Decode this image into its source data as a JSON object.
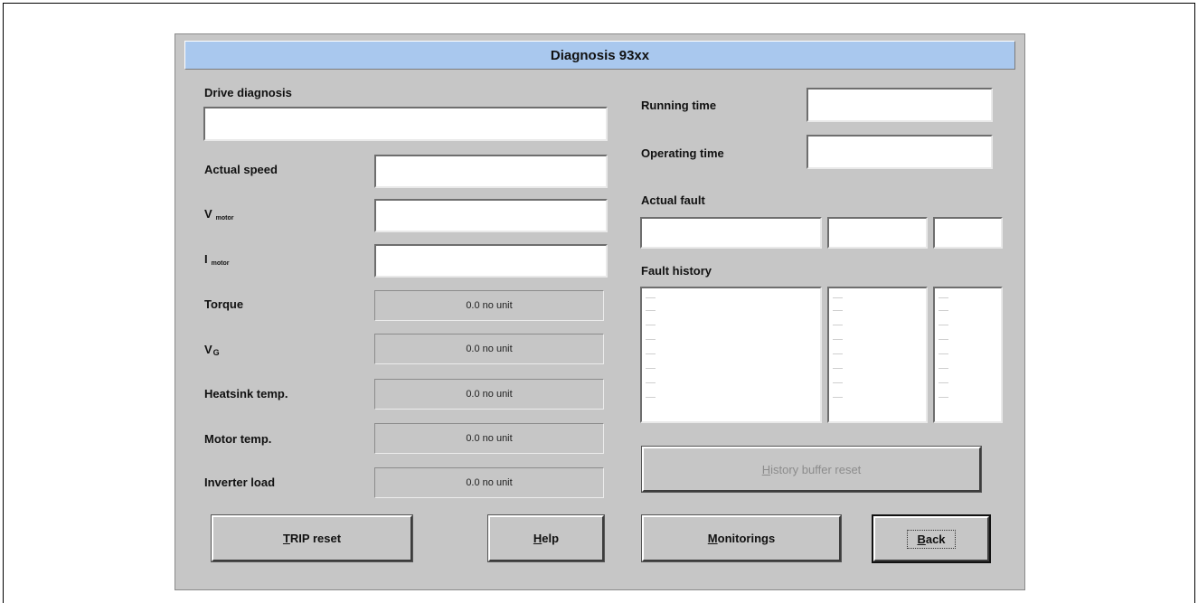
{
  "window": {
    "title": "Diagnosis 93xx"
  },
  "labels": {
    "drive_diagnosis": "Drive diagnosis",
    "actual_speed": "Actual speed",
    "v_motor": "V",
    "v_motor_sub": "motor",
    "i_motor": "I",
    "i_motor_sub": "motor",
    "torque": "Torque",
    "vg": "V",
    "vg_sub": "G",
    "heatsink_temp": "Heatsink temp.",
    "motor_temp": "Motor temp.",
    "inverter_load": "Inverter load",
    "running_time": "Running time",
    "operating_time": "Operating time",
    "actual_fault": "Actual fault",
    "fault_history": "Fault history"
  },
  "values": {
    "drive_diagnosis": "",
    "actual_speed": "",
    "v_motor": "",
    "i_motor": "",
    "torque": "0.0 no unit",
    "vg": "0.0 no unit",
    "heatsink_temp": "0.0 no unit",
    "motor_temp": "0.0 no unit",
    "inverter_load": "0.0 no unit",
    "running_time": "",
    "operating_time": "",
    "actual_fault_code": "",
    "actual_fault_time": "",
    "actual_fault_count": ""
  },
  "buttons": {
    "history_reset_accel": "H",
    "history_reset_rest": "istory buffer reset",
    "trip_reset_accel": "T",
    "trip_reset_rest": "RIP reset",
    "help_accel": "H",
    "help_rest": "elp",
    "monitorings_accel": "M",
    "monitorings_rest": "onitorings",
    "back_accel": "B",
    "back_rest": "ack"
  }
}
